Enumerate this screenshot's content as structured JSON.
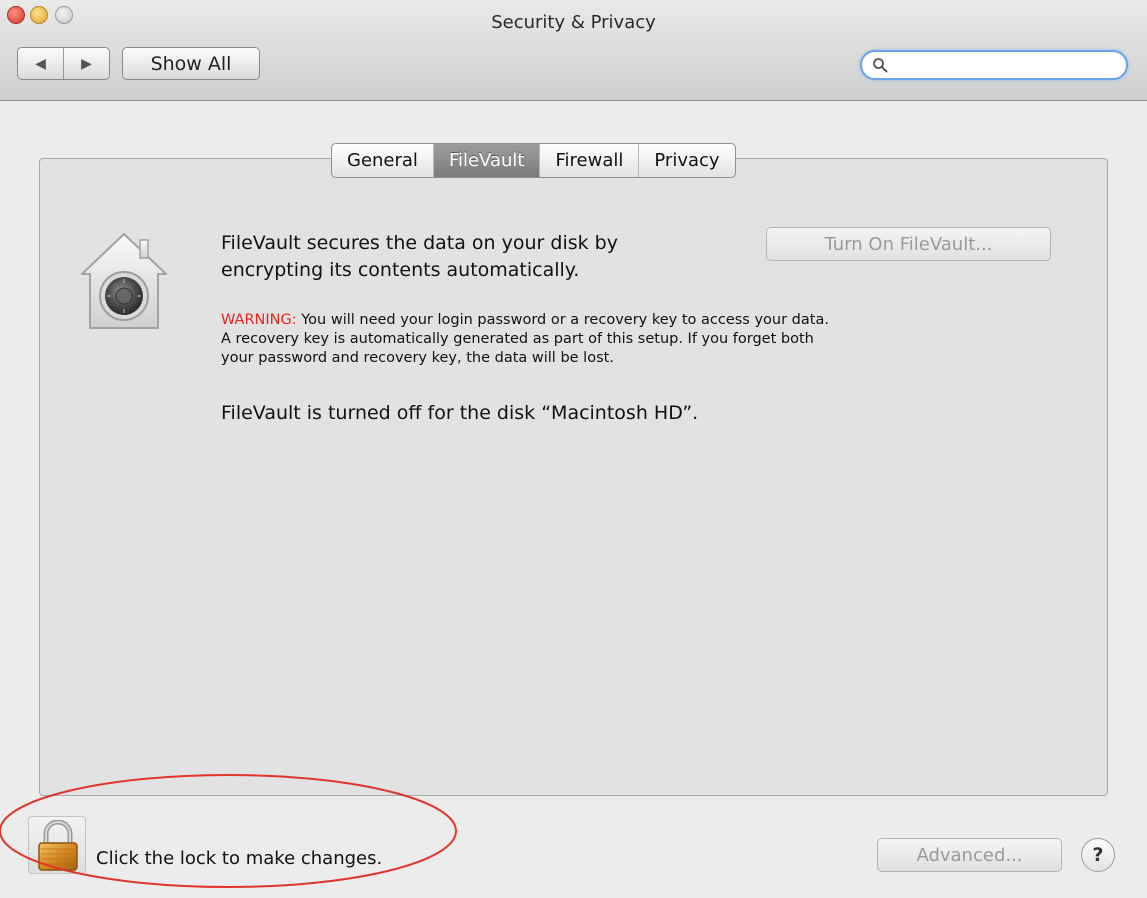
{
  "window": {
    "title": "Security & Privacy"
  },
  "toolbar": {
    "back_icon": "back-arrow-icon",
    "forward_icon": "forward-arrow-icon",
    "back_glyph": "◀",
    "forward_glyph": "▶",
    "show_all_label": "Show All",
    "search": {
      "value": "",
      "placeholder": "",
      "icon": "magnifier-icon"
    }
  },
  "tabs": [
    {
      "label": "General",
      "active": false
    },
    {
      "label": "FileVault",
      "active": true
    },
    {
      "label": "Firewall",
      "active": false
    },
    {
      "label": "Privacy",
      "active": false
    }
  ],
  "filevault": {
    "icon": "filevault-house-icon",
    "description_line1": "FileVault secures the data on your disk by",
    "description_line2": "encrypting its contents automatically.",
    "turn_on_label": "Turn On FileVault...",
    "warning_label": "WARNING:",
    "warning_line1": " You will need your login password or a recovery key to access your data.",
    "warning_line2": "A recovery key is automatically generated as part of this setup. If you forget both",
    "warning_line3": "your password and recovery key, the data will be lost.",
    "status": "FileVault is turned off for the disk “Macintosh HD”."
  },
  "footer": {
    "lock_icon": "padlock-icon",
    "lock_text": "Click the lock to make changes.",
    "advanced_label": "Advanced...",
    "help_label": "?"
  },
  "colors": {
    "warning": "#e8251f",
    "annotation": "#e0362c",
    "search_focus": "#6ba2e8",
    "active_tab": "#8a8a8a"
  }
}
